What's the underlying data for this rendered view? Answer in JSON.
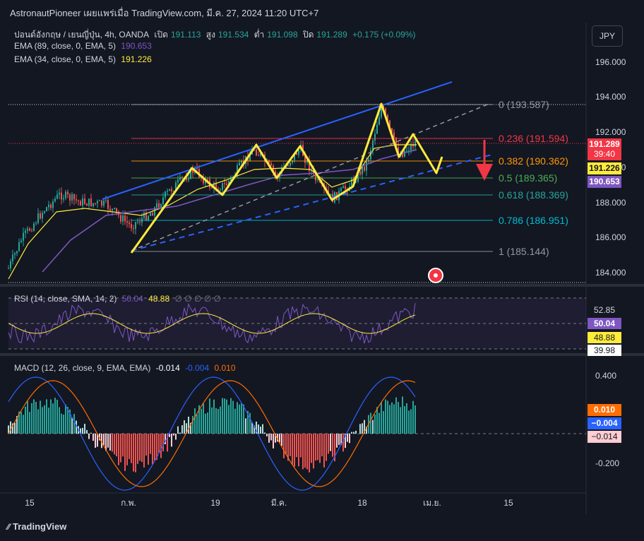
{
  "header": {
    "title": "AstronautPioneer เผยแพร่เมื่อ TradingView.com, มี.ค. 27, 2024 11:20 UTC+7"
  },
  "symbol": {
    "name": "ปอนด์อังกฤษ / เยนญี่ปุ่น, 4h, OANDA",
    "open_label": "เปิด",
    "open": "191.113",
    "high_label": "สูง",
    "high": "191.534",
    "low_label": "ต่ำ",
    "low": "191.098",
    "close_label": "ปิด",
    "close": "191.289",
    "change": "+0.175 (+0.09%)"
  },
  "indicators": {
    "ema89": {
      "label": "EMA (89, close, 0, EMA, 5)",
      "value": "190.653",
      "color": "#7e57c2"
    },
    "ema34": {
      "label": "EMA (34, close, 0, EMA, 5)",
      "value": "191.226",
      "color": "#ffeb3b"
    }
  },
  "currency_button": "JPY",
  "price_axis": [
    "196.000",
    "194.000",
    "192.000",
    "190.000",
    "188.000",
    "186.000",
    "184.000"
  ],
  "price_badges": {
    "current": "191.289",
    "countdown": "39:40",
    "ema34": "191.226",
    "ema89": "190.653"
  },
  "fib": [
    {
      "label": "0 (193.587)",
      "color": "#9598a1"
    },
    {
      "label": "0.236 (191.594)",
      "color": "#f23645"
    },
    {
      "label": "0.382 (190.362)",
      "color": "#ff9800"
    },
    {
      "label": "0.5 (189.365)",
      "color": "#4caf50"
    },
    {
      "label": "0.618 (188.369)",
      "color": "#26a69a"
    },
    {
      "label": "0.786 (186.951)",
      "color": "#00bcd4"
    },
    {
      "label": "1 (185.144)",
      "color": "#9598a1"
    }
  ],
  "rsi": {
    "label": "RSI (14, close, SMA, 14, 2)",
    "rsi_value": "50.04",
    "sma_value": "48.88",
    "extra": "∅ ∅ ∅ ∅ ∅",
    "axis": [
      "52.85",
      "50.04",
      "48.88",
      "39.98"
    ]
  },
  "macd": {
    "label": "MACD (12, 26, close, 9, EMA, EMA)",
    "hist": "-0.014",
    "macd": "-0.004",
    "signal": "0.010",
    "axis": [
      "0.400",
      "-0.200"
    ],
    "badges": [
      "0.010",
      "−0.004",
      "−0.014"
    ]
  },
  "time_axis": [
    "15",
    "ก.พ.",
    "19",
    "มี.ค.",
    "18",
    "เม.ย.",
    "15"
  ],
  "footer": {
    "logo": "TradingView"
  }
}
